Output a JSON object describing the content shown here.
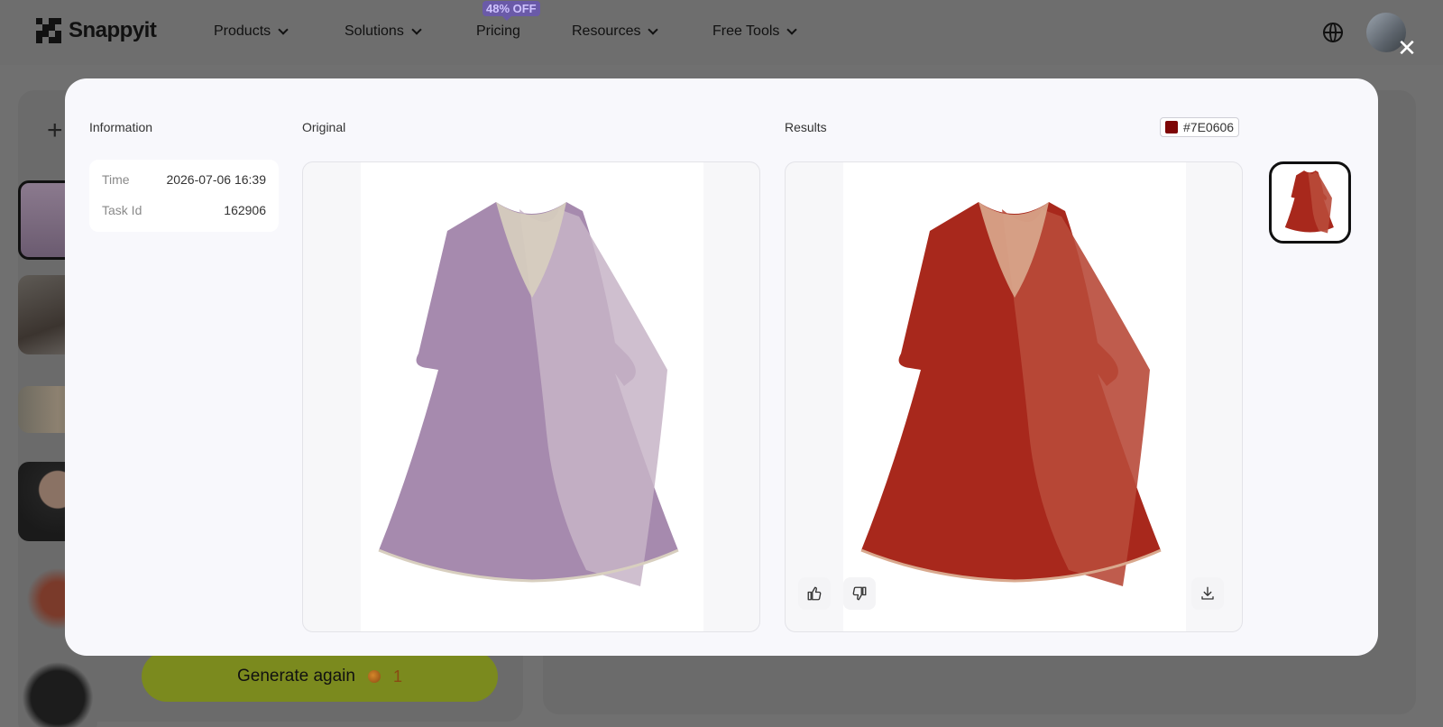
{
  "header": {
    "brand": "Snappyit",
    "nav": [
      {
        "label": "Products"
      },
      {
        "label": "Solutions"
      },
      {
        "label": "Pricing",
        "badge": "48% OFF"
      },
      {
        "label": "Resources"
      },
      {
        "label": "Free Tools"
      }
    ]
  },
  "workspace": {
    "generate_label": "Generate again",
    "credits": "1"
  },
  "modal": {
    "information_label": "Information",
    "original_label": "Original",
    "results_label": "Results",
    "info": {
      "time_label": "Time",
      "time_value": "2026-07-06 16:39",
      "task_label": "Task Id",
      "task_value": "162906"
    },
    "result_color": "#7E0606",
    "original_color": "#a68aae",
    "close_glyph": "✕"
  }
}
